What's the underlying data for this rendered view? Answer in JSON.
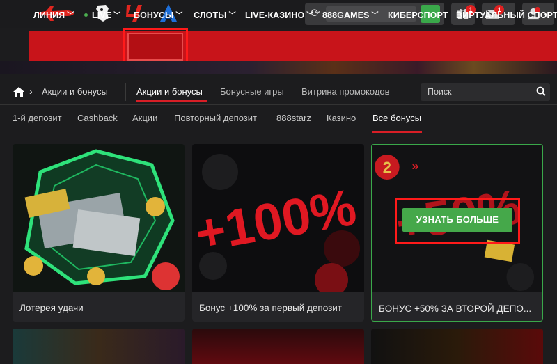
{
  "header": {
    "logos": [
      "plane-logo",
      "premier-league-logo",
      "laliga-logo",
      "serie-a-logo"
    ],
    "gift_badge": "1",
    "mail_badge": "1"
  },
  "nav": {
    "items": [
      {
        "label": "ЛИНИЯ"
      },
      {
        "label": "LIVE"
      },
      {
        "label": "БОНУСЫ"
      },
      {
        "label": "СЛОТЫ"
      },
      {
        "label": "LIVE-КАЗИНО"
      },
      {
        "label": "888GAMES"
      },
      {
        "label": "КИБЕРСПОРТ"
      },
      {
        "label": "ВИРТУАЛЬНЫЙ СПОРТ"
      }
    ]
  },
  "breadcrumb": {
    "current": "Акции и бонусы"
  },
  "tabs": [
    {
      "label": "Акции и бонусы"
    },
    {
      "label": "Бонусные игры"
    },
    {
      "label": "Витрина промокодов"
    }
  ],
  "search": {
    "placeholder": "Поиск"
  },
  "categories": [
    {
      "label": "1-й депозит"
    },
    {
      "label": "Cashback"
    },
    {
      "label": "Акции"
    },
    {
      "label": "Повторный депозит"
    },
    {
      "label": "888starz"
    },
    {
      "label": "Казино"
    },
    {
      "label": "Все бонусы"
    }
  ],
  "cards": [
    {
      "title": "Лотерея удачи"
    },
    {
      "title": "Бонус +100% за первый депозит",
      "promo_text": "+100%"
    },
    {
      "title": "БОНУС +50% ЗА ВТОРОЙ ДЕПО...",
      "promo_text": "+50%",
      "step": "2",
      "button": "УЗНАТЬ БОЛЬШЕ"
    }
  ],
  "colors": {
    "accent_red": "#c8141a",
    "highlight": "#ff1a1a",
    "green": "#45a84a"
  }
}
